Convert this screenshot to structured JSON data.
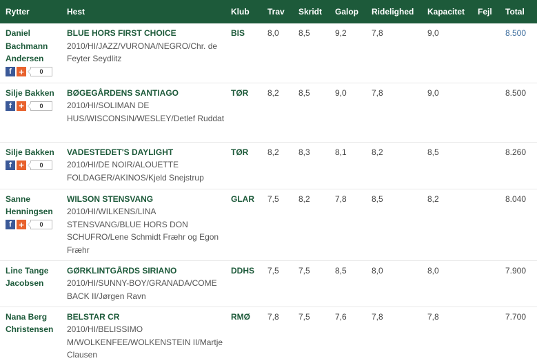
{
  "headers": {
    "rider": "Rytter",
    "horse": "Hest",
    "club": "Klub",
    "trav": "Trav",
    "skridt": "Skridt",
    "galop": "Galop",
    "ridelighed": "Ridelighed",
    "kapacitet": "Kapacitet",
    "fejl": "Fejl",
    "total": "Total"
  },
  "social": {
    "facebook_icon": "facebook-icon",
    "plus_icon": "plus-icon"
  },
  "rows": [
    {
      "rider": "Daniel Bachmann Andersen",
      "horse_name": "BLUE HORS FIRST CHOICE",
      "horse_info": "2010/HI/JAZZ/VURONA/NEGRO/Chr. de Feyter Seydlitz",
      "club": "BIS",
      "trav": "8,0",
      "skridt": "8,5",
      "galop": "9,2",
      "ridelighed": "7,8",
      "kapacitet": "9,0",
      "fejl": "",
      "total": "8.500",
      "share_count": "0"
    },
    {
      "rider": "Silje Bakken",
      "horse_name": "BØGEGÅRDENS SANTIAGO",
      "horse_info": "2010/HI/SOLIMAN DE HUS/WISCONSIN/WESLEY/Detlef Ruddat",
      "club": "TØR",
      "trav": "8,2",
      "skridt": "8,5",
      "galop": "9,0",
      "ridelighed": "7,8",
      "kapacitet": "9,0",
      "fejl": "",
      "total": "8.500",
      "share_count": "0"
    },
    {
      "rider": "Silje Bakken",
      "horse_name": "VADESTEDET'S DAYLIGHT",
      "horse_info": "2010/HI/DE NOIR/ALOUETTE FOLDAGER/AKINOS/Kjeld Snejstrup",
      "club": "TØR",
      "trav": "8,2",
      "skridt": "8,3",
      "galop": "8,1",
      "ridelighed": "8,2",
      "kapacitet": "8,5",
      "fejl": "",
      "total": "8.260",
      "share_count": "0"
    },
    {
      "rider": "Sanne Henningsen",
      "horse_name": "WILSON STENSVANG",
      "horse_info": "2010/HI/WILKENS/LINA STENSVANG/BLUE HORS DON SCHUFRO/Lene Schmidt Fræhr og Egon Fræhr",
      "club": "GLAR",
      "trav": "7,5",
      "skridt": "8,2",
      "galop": "7,8",
      "ridelighed": "8,5",
      "kapacitet": "8,2",
      "fejl": "",
      "total": "8.040",
      "share_count": "0"
    },
    {
      "rider": "Line Tange Jacobsen",
      "horse_name": "GØRKLINTGÅRDS SIRIANO",
      "horse_info": "2010/HI/SUNNY-BOY/GRANADA/COME BACK II/Jørgen Ravn",
      "club": "DDHS",
      "trav": "7,5",
      "skridt": "7,5",
      "galop": "8,5",
      "ridelighed": "8,0",
      "kapacitet": "8,0",
      "fejl": "",
      "total": "7.900"
    },
    {
      "rider": "Nana Berg Christensen",
      "horse_name": "BELSTAR CR",
      "horse_info": "2010/HI/BELISSIMO M/WOLKENFEE/WOLKENSTEIN II/Martje Clausen",
      "club": "RMØ",
      "trav": "7,8",
      "skridt": "7,5",
      "galop": "7,6",
      "ridelighed": "7,8",
      "kapacitet": "7,8",
      "fejl": "",
      "total": "7.700"
    }
  ]
}
